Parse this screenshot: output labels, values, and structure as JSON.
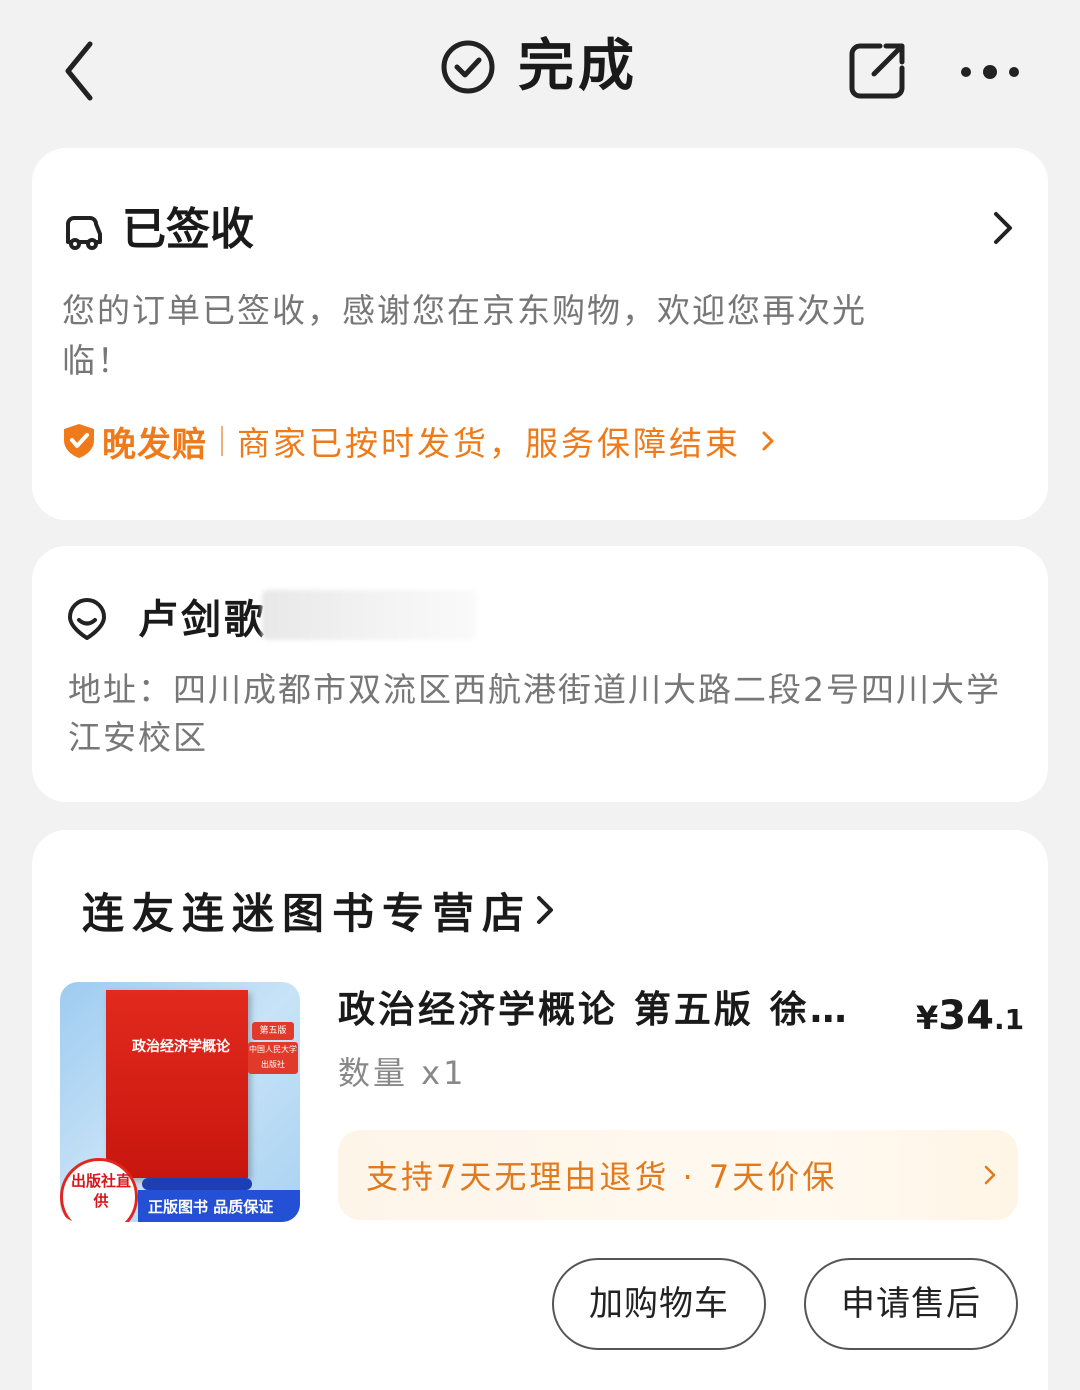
{
  "header": {
    "title": "完成",
    "icons": {
      "back": "back-arrow-icon",
      "status": "check-circle-icon",
      "share": "share-icon",
      "more": "more-dots-icon"
    }
  },
  "delivery": {
    "status": "已签收",
    "description": "您的订单已签收，感谢您在京东购物，欢迎您再次光临！",
    "guarantee_badge": "晚发赔",
    "guarantee_text": "商家已按时发货，服务保障结束",
    "accent_color": "#ef7a1a"
  },
  "recipient": {
    "name": "卢剑歌",
    "address": "地址：四川成都市双流区西航港街道川大路二段2号四川大学江安校区"
  },
  "order": {
    "shop_name": "连友连迷图书专营店",
    "product": {
      "title": "政治经济学概论 第五版 徐…",
      "price_currency": "¥",
      "price_int": "34",
      "price_dec": ".1",
      "quantity": "数量 x1",
      "service": "支持7天无理由退货 · 7天价保",
      "image": {
        "book_title": "政治经济学概论",
        "edition": "第五版",
        "publisher": "中国人民大学出版社",
        "badge_circle": "出版社直供",
        "badge_bar": "正版图书 品质保证"
      }
    },
    "buttons": {
      "add_cart": "加购物车",
      "after_sale": "申请售后"
    }
  }
}
